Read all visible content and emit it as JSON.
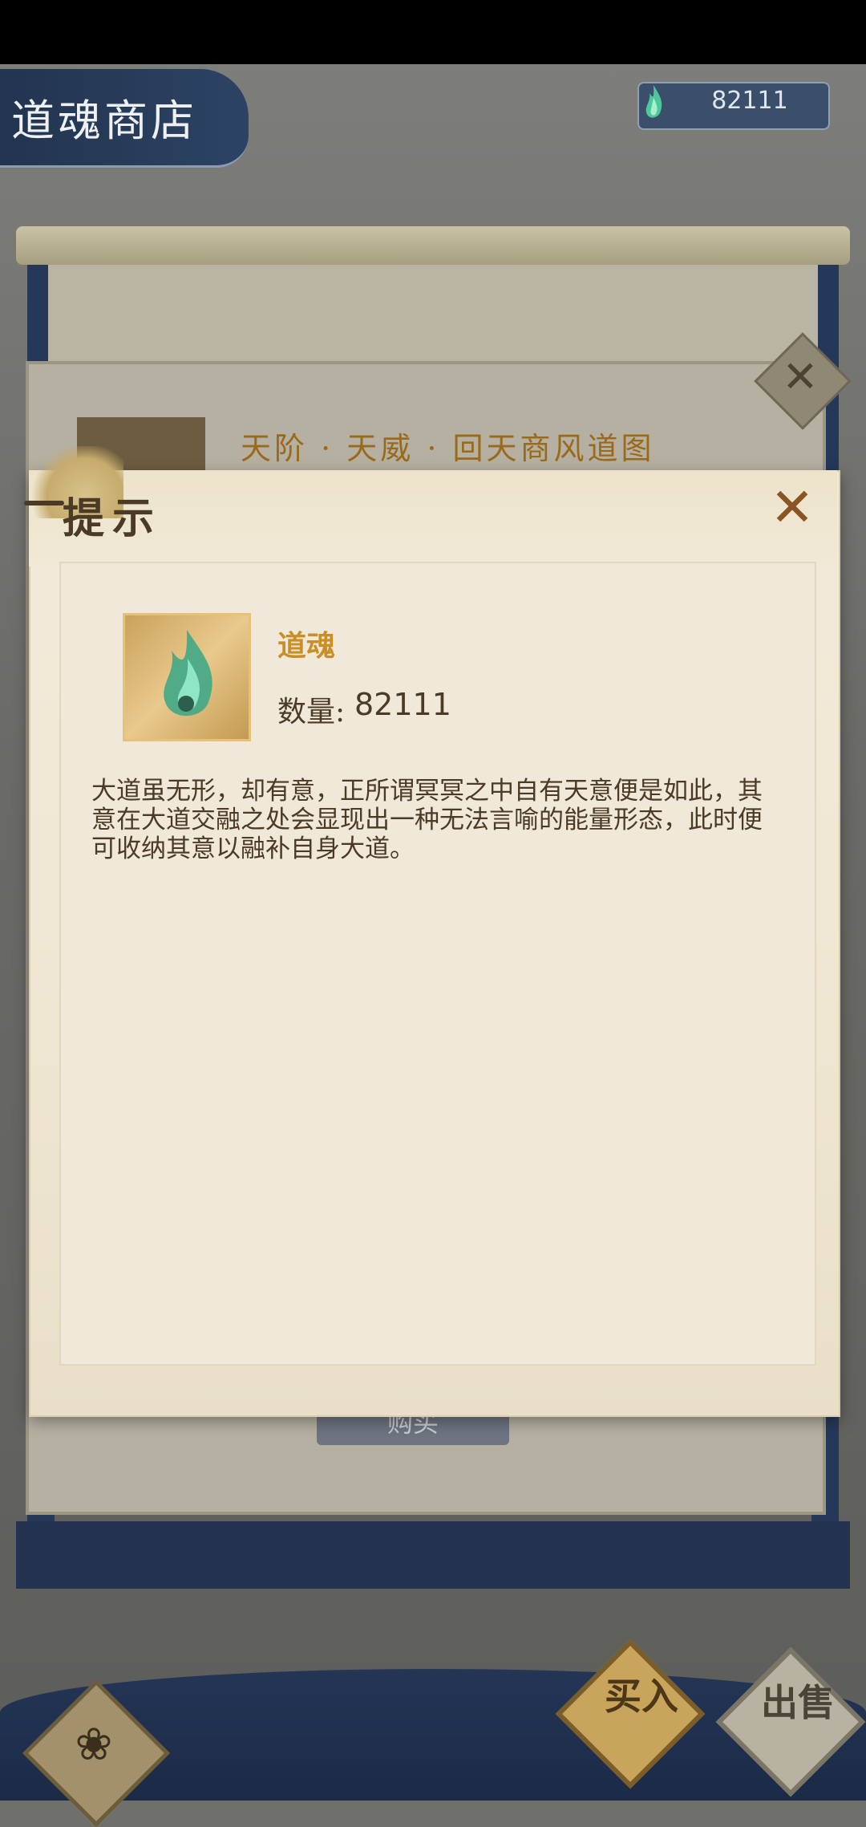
{
  "header": {
    "title": "道魂商店",
    "currency_value": "82111",
    "currency_icon": "green-soul-flame-icon"
  },
  "background_card": {
    "title": "天阶 · 天威 · 回天商风道图",
    "buy_label": "购买"
  },
  "dialog": {
    "title": "提示",
    "item": {
      "name": "道魂",
      "quantity_label": "数量:",
      "quantity_value": "82111",
      "description": "大道虽无形，却有意，正所谓冥冥之中自有天意便是如此，其意在大道交融之处会显现出一种无法言喻的能量形态，此时便可收纳其意以融补自身大道。"
    }
  },
  "bottom_nav": {
    "buy_label": "买入",
    "sell_label": "出售"
  },
  "colors": {
    "navy": "#26385a",
    "parchment": "#f0e8d8",
    "gold_text": "#c98f25",
    "brown_text": "#4b3a26"
  }
}
